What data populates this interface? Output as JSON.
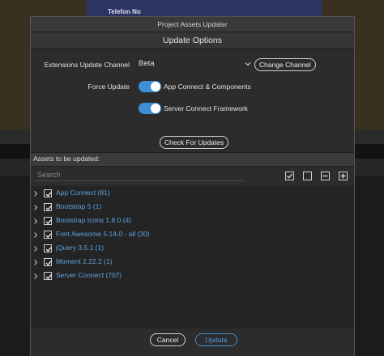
{
  "background": {
    "panel_label": "Telefon No"
  },
  "dialog": {
    "title": "Project Assets Updater",
    "section_title": "Update Options",
    "channel": {
      "label": "Extensions Update Channel",
      "value": "Beta",
      "change_button": "Change Channel"
    },
    "force_update": {
      "label": "Force Update",
      "toggles": [
        {
          "label": "App Connect & Components",
          "on": true
        },
        {
          "label": "Server Connect Framework",
          "on": true
        }
      ]
    },
    "check_button": "Check For Updates",
    "assets": {
      "header": "Assets to be updated:",
      "search_placeholder": "Search",
      "items": [
        {
          "label": "App Connect (81)",
          "checked": true
        },
        {
          "label": "Bootstrap 5 (1)",
          "checked": true
        },
        {
          "label": "Bootstrap Icons 1.8.0 (4)",
          "checked": true
        },
        {
          "label": "Font Awesome 5.14.0 - all (30)",
          "checked": true
        },
        {
          "label": "jQuery 3.5.1 (1)",
          "checked": true
        },
        {
          "label": "Moment 2.22.2 (1)",
          "checked": true
        },
        {
          "label": "Server Connect (707)",
          "checked": true
        }
      ]
    },
    "footer": {
      "cancel": "Cancel",
      "update": "Update"
    },
    "colors": {
      "accent": "#3f8fd4",
      "item_text": "#5fa3e0"
    }
  }
}
